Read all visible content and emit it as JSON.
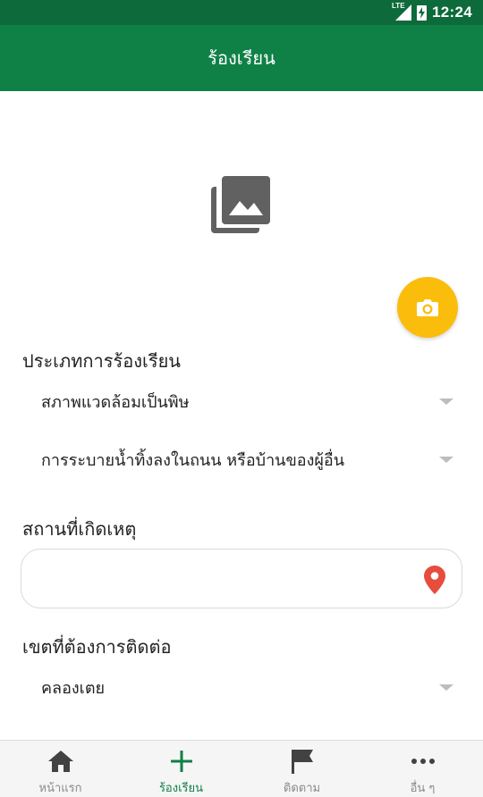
{
  "status_bar": {
    "time": "12:24",
    "network": "LTE"
  },
  "header": {
    "title": "ร้องเรียน"
  },
  "media": {
    "gallery_icon": "photo-library-icon",
    "camera_icon": "camera-icon"
  },
  "form": {
    "complaint_type": {
      "label": "ประเภทการร้องเรียน",
      "category_value": "สภาพแวดล้อมเป็นพิษ",
      "subcategory_value": "การระบายน้ำทิ้งลงในถนน หรือบ้านของผู้อื่น"
    },
    "location": {
      "label": "สถานที่เกิดเหตุ",
      "value": "",
      "icon": "location-pin-icon"
    },
    "district": {
      "label": "เขตที่ต้องการติดต่อ",
      "value": "คลองเตย"
    }
  },
  "bottom_nav": [
    {
      "label": "หน้าแรก",
      "icon": "home-icon",
      "active": false
    },
    {
      "label": "ร้องเรียน",
      "icon": "plus-icon",
      "active": true
    },
    {
      "label": "ติดตาม",
      "icon": "flag-icon",
      "active": false
    },
    {
      "label": "อื่น ๆ",
      "icon": "more-icon",
      "active": false
    }
  ],
  "colors": {
    "status_bar": "#0d6a3b",
    "app_bar": "#0f8046",
    "fab": "#fbbd0c",
    "pin": "#e74c3c",
    "active_nav": "#0f8046",
    "inactive_nav": "#8a8a8a"
  }
}
